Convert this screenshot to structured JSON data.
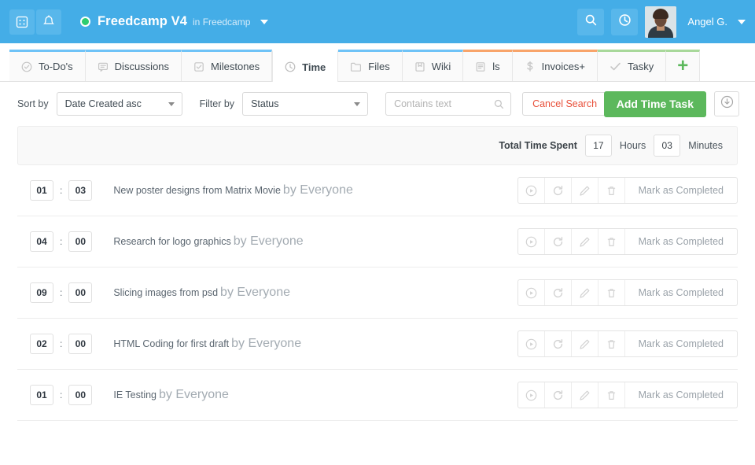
{
  "topbar": {
    "apps_icon": "grid-icon",
    "bell_icon": "bell-icon",
    "project_name": "Freedcamp V4",
    "project_scope": "in Freedcamp",
    "status_dot_color": "#2ecc71",
    "search_icon": "search-icon",
    "history_icon": "clock-icon",
    "user_name": "Angel G.",
    "bg_color": "#44ade7"
  },
  "tabs": [
    {
      "label": "To-Do's",
      "icon": "check-circle-icon",
      "accent": "blue",
      "active": false
    },
    {
      "label": "Discussions",
      "icon": "comment-icon",
      "accent": "blue",
      "active": false
    },
    {
      "label": "Milestones",
      "icon": "checkbox-icon",
      "accent": "blue",
      "active": false
    },
    {
      "label": "Time",
      "icon": "clock-icon",
      "accent": "none",
      "active": true
    },
    {
      "label": "Files",
      "icon": "folder-icon",
      "accent": "blue",
      "active": false
    },
    {
      "label": "Wiki",
      "icon": "book-icon",
      "accent": "blue",
      "active": false
    },
    {
      "label": "ls",
      "icon": "document-icon",
      "accent": "orange",
      "active": false
    },
    {
      "label": "Invoices+",
      "icon": "dollar-icon",
      "accent": "orange",
      "active": false
    },
    {
      "label": "Tasky",
      "icon": "check-icon",
      "accent": "green",
      "active": false
    }
  ],
  "add_tab": {
    "icon": "plus-icon",
    "label": "+"
  },
  "toolbar": {
    "sort_label": "Sort by",
    "sort_value": "Date Created asc",
    "filter_label": "Filter by",
    "filter_value": "Status",
    "search_placeholder": "Contains text",
    "search_value": "",
    "search_icon": "search-icon",
    "cancel_search_label": "Cancel Search",
    "cancel_search_icon": "x-icon",
    "add_button_label": "Add Time Task",
    "add_button_color": "#5cb85c",
    "download_icon": "download-circle-icon"
  },
  "total_header": {
    "label": "Total Time Spent",
    "hours_value": "17",
    "hours_unit": "Hours",
    "minutes_value": "03",
    "minutes_unit": "Minutes"
  },
  "row_actions": {
    "play_icon": "play-circle-icon",
    "restart_icon": "restart-icon",
    "edit_icon": "pencil-icon",
    "delete_icon": "trash-icon",
    "complete_label": "Mark as Completed"
  },
  "rows": [
    {
      "hours": "01",
      "minutes": "03",
      "separator": ":",
      "task": "New poster designs from Matrix Movie",
      "by": "by Everyone"
    },
    {
      "hours": "04",
      "minutes": "00",
      "separator": ":",
      "task": "Research for logo graphics",
      "by": "by Everyone"
    },
    {
      "hours": "09",
      "minutes": "00",
      "separator": ":",
      "task": "Slicing images from psd",
      "by": "by Everyone"
    },
    {
      "hours": "02",
      "minutes": "00",
      "separator": ":",
      "task": "HTML Coding for first draft",
      "by": "by Everyone"
    },
    {
      "hours": "01",
      "minutes": "00",
      "separator": ":",
      "task": "IE Testing",
      "by": "by Everyone"
    }
  ]
}
